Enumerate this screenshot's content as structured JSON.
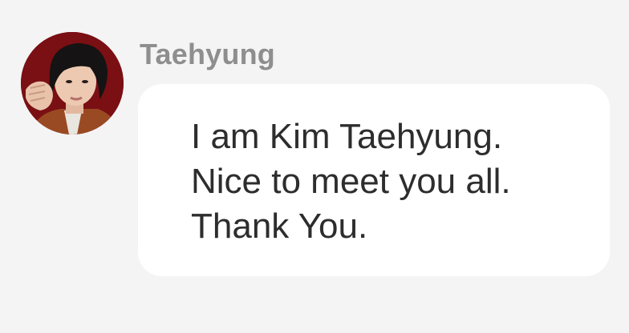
{
  "message": {
    "sender": "Taehyung",
    "avatar_icon": "profile-photo",
    "lines": [
      "I am Kim Taehyung.",
      "Nice to meet you all.",
      "Thank You."
    ]
  },
  "colors": {
    "background": "#f4f4f4",
    "bubble": "#ffffff",
    "sender_text": "#8e8e8e",
    "message_text": "#2d2d2d",
    "avatar_bg": "#7a0f14"
  }
}
